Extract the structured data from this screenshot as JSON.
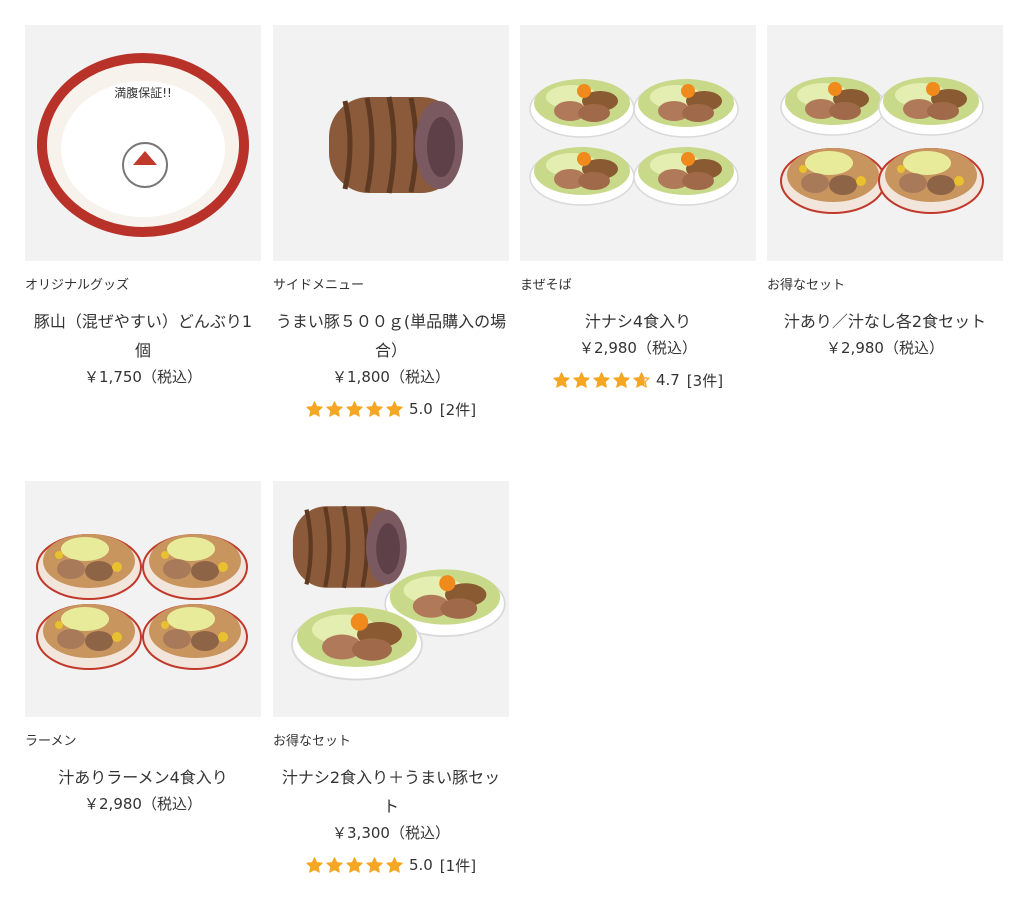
{
  "colors": {
    "star": "#f5a623",
    "thumb_bg": "#f2f2f2",
    "text": "#333333"
  },
  "products": [
    {
      "category": "オリジナルグッズ",
      "name": "豚山（混ぜやすい）どんぶり1個",
      "price": "￥1,750（税込）",
      "image": "ramen-bowl-image"
    },
    {
      "category": "サイドメニュー",
      "name": "うまい豚５００ｇ(単品購入の場合）",
      "price": "￥1,800（税込）",
      "rating": {
        "stars": 5.0,
        "value": "5.0",
        "count": "[2件]"
      },
      "image": "chashu-pork-roll-image"
    },
    {
      "category": "まぜそば",
      "name": "汁ナシ4食入り",
      "price": "￥2,980（税込）",
      "rating": {
        "stars": 4.7,
        "value": "4.7",
        "count": "[3件]"
      },
      "image": "mazesoba-4-bowls-image"
    },
    {
      "category": "お得なセット",
      "name": "汁あり／汁なし各2食セット",
      "price": "￥2,980（税込）",
      "image": "mixed-set-4-bowls-image"
    },
    {
      "category": "ラーメン",
      "name": "汁ありラーメン4食入り",
      "price": "￥2,980（税込）",
      "image": "ramen-4-bowls-image"
    },
    {
      "category": "お得なセット",
      "name": "汁ナシ2食入り＋うまい豚セット",
      "price": "￥3,300（税込）",
      "rating": {
        "stars": 5.0,
        "value": "5.0",
        "count": "[1件]"
      },
      "image": "mazesoba-and-pork-set-image"
    }
  ]
}
